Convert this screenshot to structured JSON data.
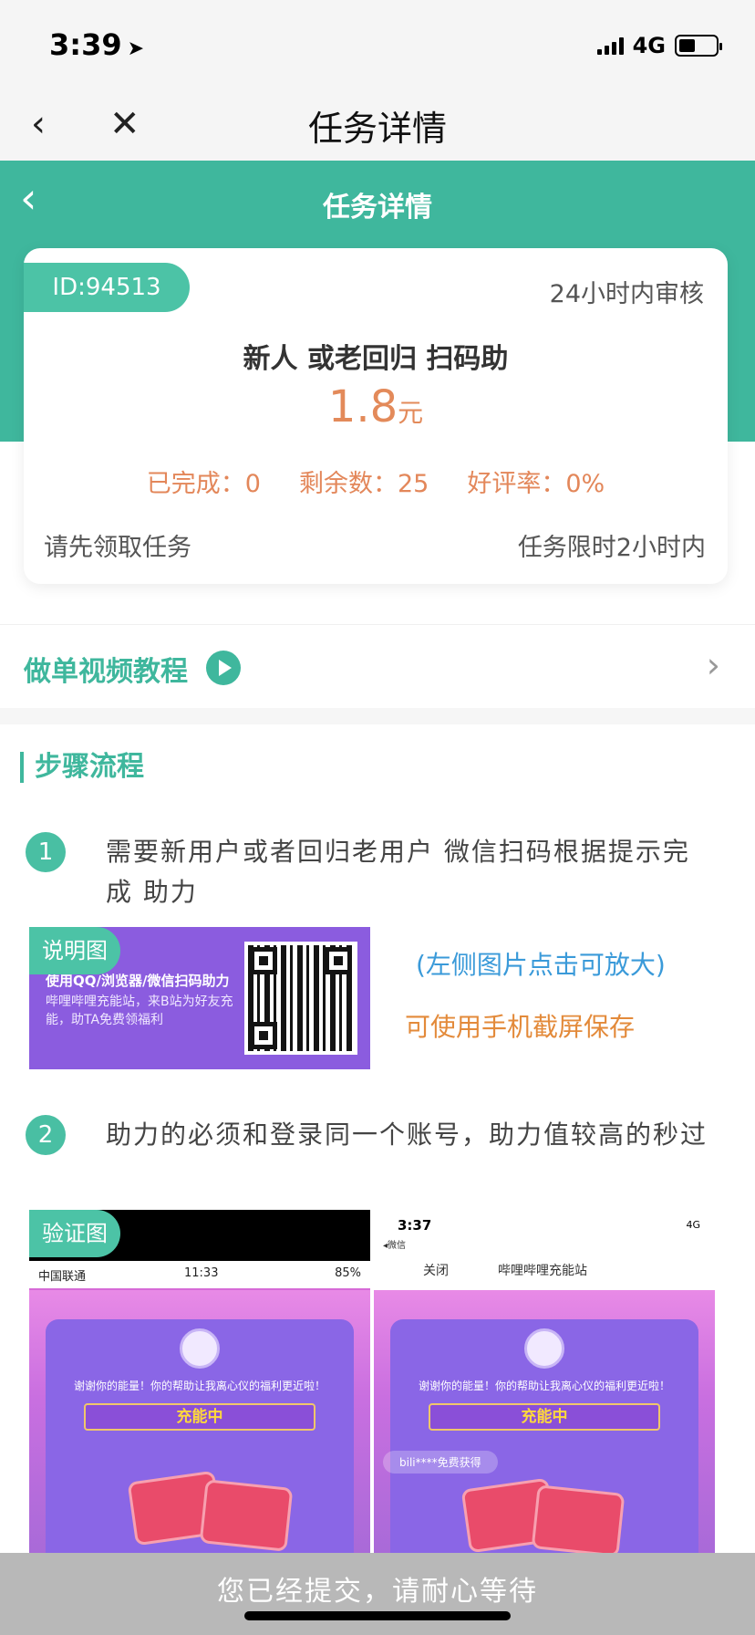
{
  "status_bar": {
    "time": "3:39",
    "network": "4G"
  },
  "wechat_nav": {
    "title": "任务详情",
    "back": "‹",
    "close": "✕"
  },
  "header": {
    "title": "任务详情",
    "back": "‹"
  },
  "task": {
    "id": "ID:94513",
    "review": "24小时内审核",
    "name": "新人 或老回归 扫码助",
    "price": "1.8",
    "price_unit": "元",
    "completed": "已完成：0",
    "remaining": "剩余数：25",
    "rating": "好评率：0%",
    "notice": "请先领取任务",
    "time_limit": "任务限时2小时内"
  },
  "video": {
    "label": "做单视频教程",
    "chevron": "›"
  },
  "steps": {
    "title": "步骤流程",
    "items": [
      {
        "num": "1",
        "text": "需要新用户或者回归老用户 微信扫码根据提示完成 助力"
      },
      {
        "num": "2",
        "text": "助力的必须和登录同一个账号，助力值较高的秒过"
      }
    ]
  },
  "explain": {
    "tag": "说明图",
    "line1": "使用QQ/浏览器/微信扫码助力",
    "line2": "哔哩哔哩充能站，来B站为好友充能，助TA免费领福利",
    "hint_blue": "(左侧图片点击可放大)",
    "hint_orange": "可使用手机截屏保存"
  },
  "verify": {
    "tag": "验证图",
    "a": {
      "carrier": "中国联通",
      "time": "11:33",
      "battery": "85%",
      "message": "谢谢你的能量！你的帮助让我离心仪的福利更近啦！",
      "ribbon": "充能中"
    },
    "b": {
      "time": "3:37",
      "sub": "◂微信",
      "close": "关闭",
      "site": "哔哩哔哩充能站",
      "net": "4G",
      "message": "谢谢你的能量！你的帮助让我离心仪的福利更近啦！",
      "ribbon": "充能中",
      "watermark": "bili****免费获得"
    }
  },
  "submit": {
    "text": "您已经提交，请耐心等待"
  },
  "colors": {
    "brand": "#3fb79d",
    "accent_orange": "#e38a5a",
    "hint_blue": "#3a9ad9"
  }
}
